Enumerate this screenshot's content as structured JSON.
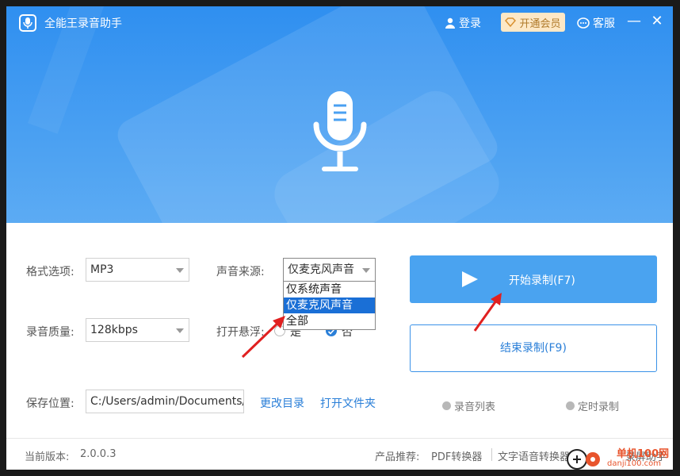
{
  "app": {
    "title": "全能王录音助手"
  },
  "titlebar": {
    "login": "登录",
    "vip": "开通会员",
    "service": "客服",
    "minimize": "—",
    "close": "✕"
  },
  "form": {
    "format_label": "格式选项:",
    "format_value": "MP3",
    "source_label": "声音来源:",
    "source_value": "仅麦克风声音",
    "source_options": [
      "仅系统声音",
      "仅麦克风声音",
      "全部"
    ],
    "quality_label": "录音质量:",
    "quality_value": "128kbps",
    "float_label": "打开悬浮:",
    "float_yes": "是",
    "float_no": "否",
    "save_label": "保存位置:",
    "save_path": "C:/Users/admin/Documents/",
    "change_dir": "更改目录",
    "open_folder": "打开文件夹"
  },
  "actions": {
    "start": "开始录制(F7)",
    "stop": "结束录制(F9)",
    "record_list": "录音列表",
    "timer_record": "定时录制"
  },
  "footer": {
    "version_label": "当前版本:",
    "version": "2.0.0.3",
    "recommend_label": "产品推荐:",
    "pdf": "PDF转换器",
    "tts": "文字语音转换器",
    "screen": "录屏助手"
  },
  "watermark": {
    "text1": "单机100网",
    "text2": "danji100.com"
  },
  "colors": {
    "accent": "#2f8ff0",
    "start_button": "#4aa3f0",
    "arrow": "#e02020",
    "selection": "#1a6fd6"
  }
}
